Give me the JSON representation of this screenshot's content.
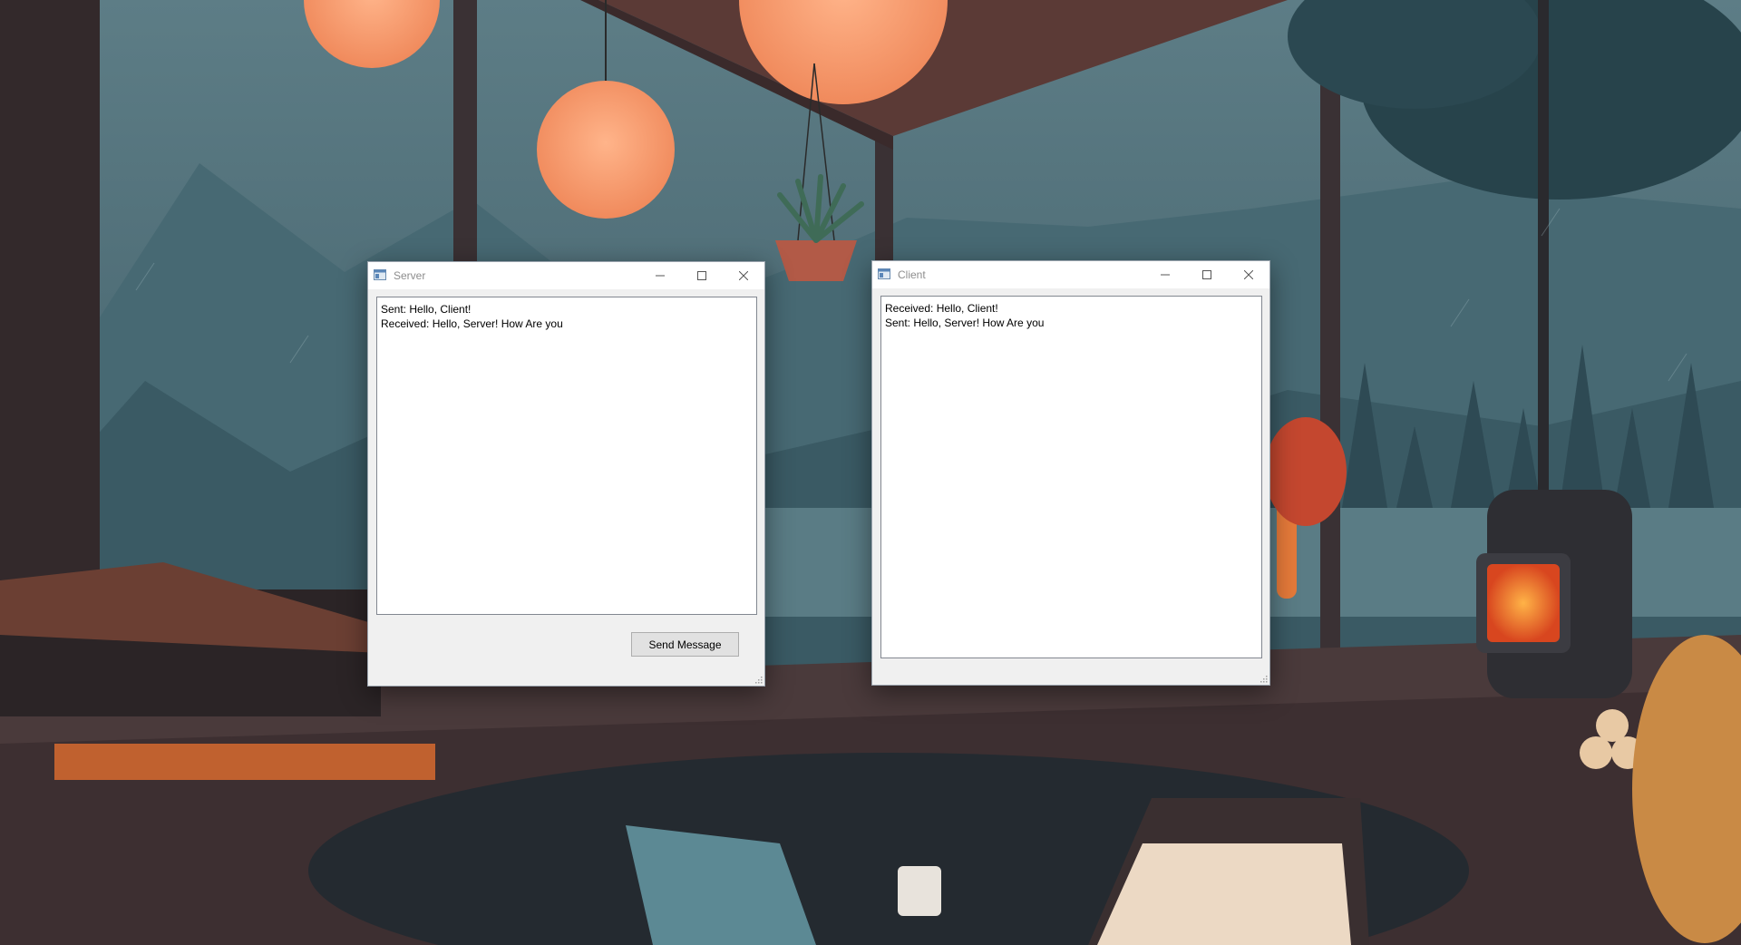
{
  "desktop": {
    "wallpaper_desc_icon": "wallpaper-image"
  },
  "server": {
    "title": "Server",
    "icon": "app-window-icon",
    "controls": {
      "minimize": "minimize-icon",
      "maximize": "maximize-icon",
      "close": "close-icon"
    },
    "log": [
      "Sent: Hello, Client!",
      "Received: Hello, Server! How Are you"
    ],
    "send_button_label": "Send  Message"
  },
  "client": {
    "title": "Client",
    "icon": "app-window-icon",
    "controls": {
      "minimize": "minimize-icon",
      "maximize": "maximize-icon",
      "close": "close-icon"
    },
    "log": [
      "Received: Hello, Client!",
      "Sent: Hello, Server! How Are you"
    ]
  },
  "colors": {
    "window_bg": "#f0f0f0",
    "titlebar_bg": "#ffffff",
    "title_text": "#8d8d8d",
    "button_bg": "#e1e1e1"
  }
}
